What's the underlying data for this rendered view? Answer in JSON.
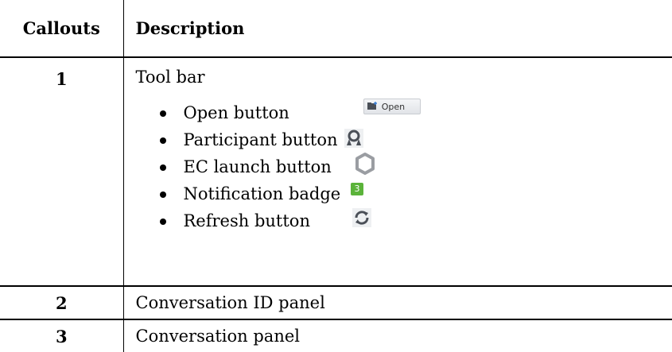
{
  "table": {
    "headers": {
      "callouts": "Callouts",
      "description": "Description"
    },
    "rows": [
      {
        "number": "1",
        "title": "Tool bar",
        "items": [
          {
            "label": "Open button",
            "icon": "open-button-icon"
          },
          {
            "label": "Participant button",
            "icon": "participant-icon"
          },
          {
            "label": "EC launch button",
            "icon": "ec-launch-icon"
          },
          {
            "label": "Notification badge",
            "icon": "notification-badge-icon"
          },
          {
            "label": "Refresh button",
            "icon": "refresh-icon"
          }
        ]
      },
      {
        "number": "2",
        "title": "Conversation ID panel"
      },
      {
        "number": "3",
        "title": "Conversation panel"
      }
    ]
  },
  "icons": {
    "open_button_label": "Open",
    "notification_count": "3",
    "badge_color": "#5bb33a"
  }
}
